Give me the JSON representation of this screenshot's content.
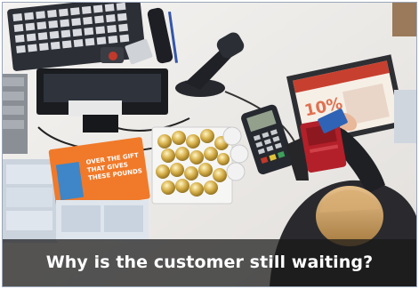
{
  "caption": "Why is the customer still waiting?",
  "scene": {
    "register_display_text": "",
    "promo_card_text": "OVER THE GIFT THAT GIVES THESE POUNDS",
    "counter_sign_text": "10%"
  },
  "colors": {
    "counter": "#eeece9",
    "caption_bar": "#191919",
    "card_orange": "#f07a2a",
    "wallet_red": "#b3202a",
    "jacket": "#2a2a2e",
    "hair": "#c89a5a"
  }
}
